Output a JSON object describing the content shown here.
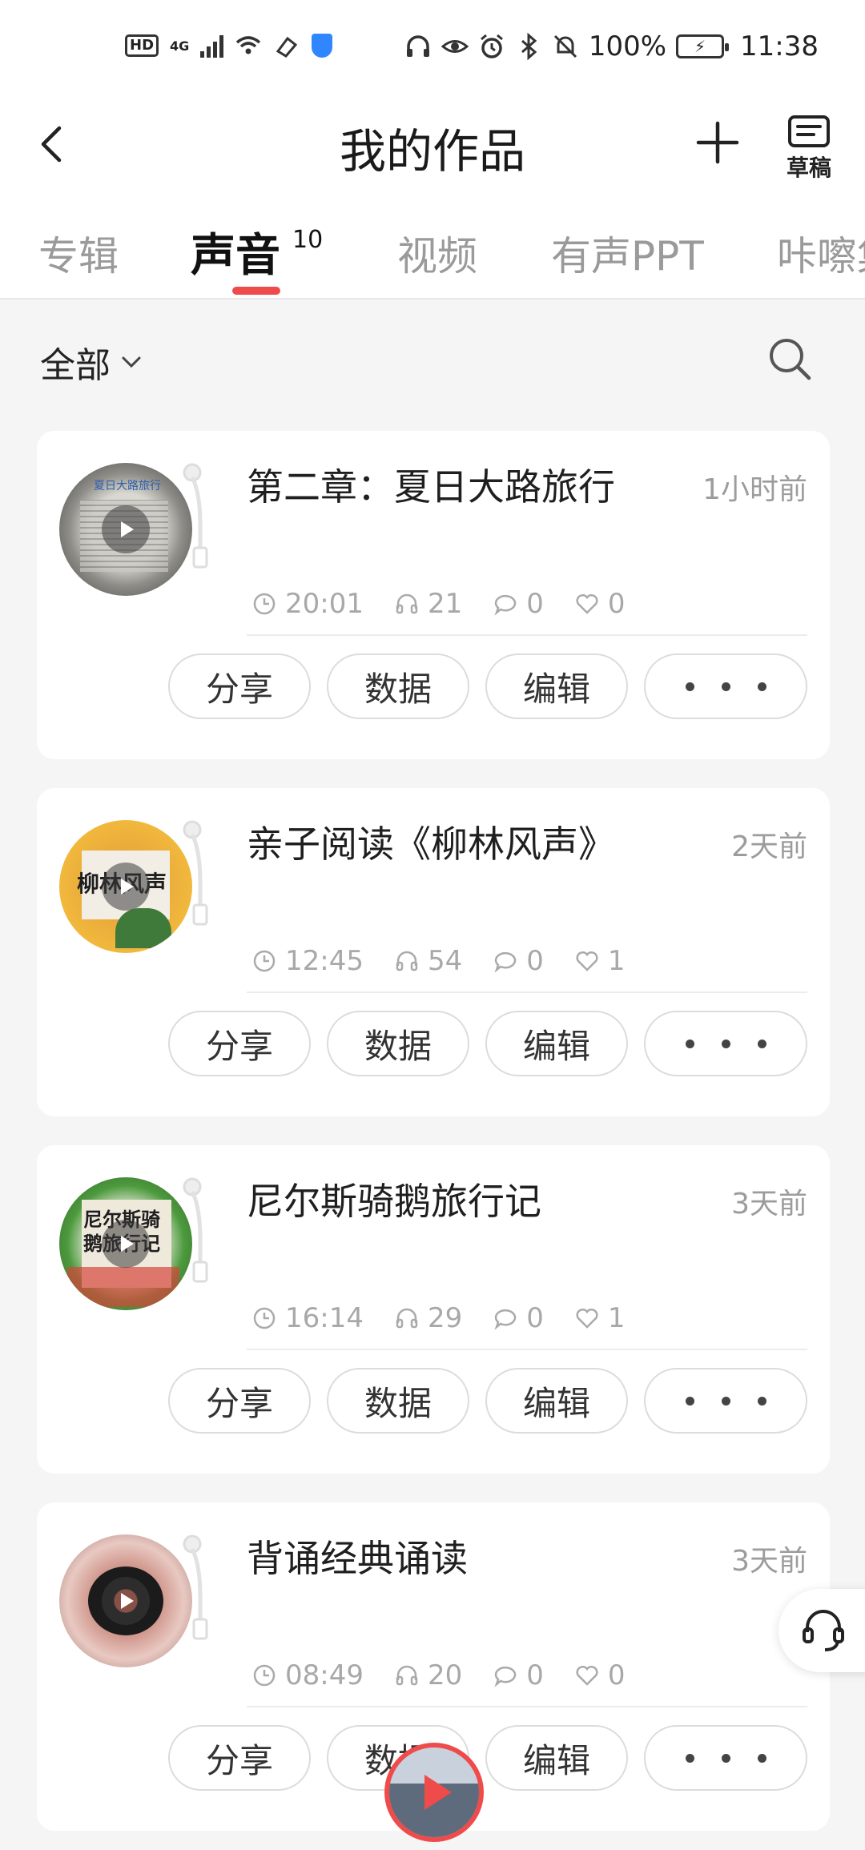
{
  "status_bar": {
    "hd": "HD",
    "network": "4G",
    "battery_pct": "100%",
    "time": "11:38",
    "icons": [
      "signal-icon",
      "wifi-icon",
      "vpn-shield-icon",
      "headphones-icon",
      "eye-icon",
      "alarm-icon",
      "bluetooth-icon",
      "mute-icon",
      "battery-icon"
    ]
  },
  "header": {
    "title": "我的作品",
    "draft_label": "草稿"
  },
  "tabs": [
    {
      "label": "专辑"
    },
    {
      "label": "声音",
      "count": "10",
      "active": true
    },
    {
      "label": "视频"
    },
    {
      "label": "有声PPT"
    },
    {
      "label": "咔嚓集"
    }
  ],
  "filter": {
    "label": "全部"
  },
  "actions": {
    "share": "分享",
    "data": "数据",
    "edit": "编辑"
  },
  "works": [
    {
      "title": "第二章：夏日大路旅行",
      "time_ago": "1小时前",
      "duration": "20:01",
      "plays": "21",
      "comments": "0",
      "likes": "0",
      "cover_text": "夏日大路旅行"
    },
    {
      "title": "亲子阅读《柳林风声》",
      "time_ago": "2天前",
      "duration": "12:45",
      "plays": "54",
      "comments": "0",
      "likes": "1",
      "cover_text": "柳林风声"
    },
    {
      "title": "尼尔斯骑鹅旅行记",
      "time_ago": "3天前",
      "duration": "16:14",
      "plays": "29",
      "comments": "0",
      "likes": "1",
      "cover_text": "尼尔斯骑鹅旅行记"
    },
    {
      "title": "背诵经典诵读",
      "time_ago": "3天前",
      "duration": "08:49",
      "plays": "20",
      "comments": "0",
      "likes": "0",
      "cover_text": ""
    }
  ],
  "colors": {
    "accent": "#f04b4b",
    "muted": "#9c9c9c",
    "card": "#ffffff",
    "background": "#f5f5f5"
  }
}
